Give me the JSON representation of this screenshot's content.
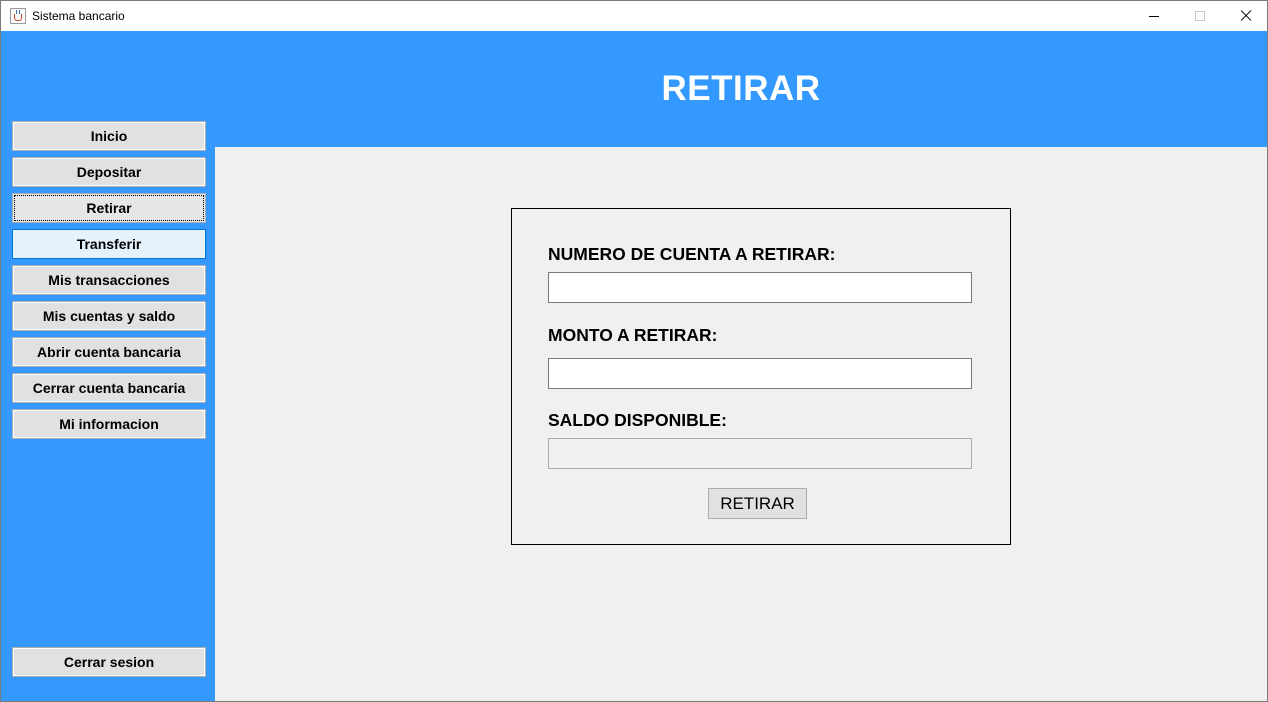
{
  "window": {
    "title": "Sistema bancario",
    "icon": "java-cup-icon",
    "controls": [
      "minimize-icon",
      "maximize-icon",
      "close-icon"
    ]
  },
  "header": {
    "title": "RETIRAR",
    "background_color": "#3399ff"
  },
  "sidebar": {
    "items": [
      {
        "label": "Inicio"
      },
      {
        "label": "Depositar"
      },
      {
        "label": "Retirar",
        "state": "focused"
      },
      {
        "label": "Transferir",
        "state": "hover"
      },
      {
        "label": "Mis transacciones"
      },
      {
        "label": "Mis cuentas y saldo"
      },
      {
        "label": "Abrir cuenta bancaria"
      },
      {
        "label": "Cerrar cuenta bancaria"
      },
      {
        "label": "Mi informacion"
      }
    ],
    "logout_label": "Cerrar sesion"
  },
  "form": {
    "account_label": "NUMERO DE CUENTA A RETIRAR:",
    "account_value": "",
    "amount_label": "MONTO A RETIRAR:",
    "amount_value": "",
    "balance_label": "SALDO DISPONIBLE:",
    "balance_value": "",
    "submit_label": "RETIRAR"
  }
}
